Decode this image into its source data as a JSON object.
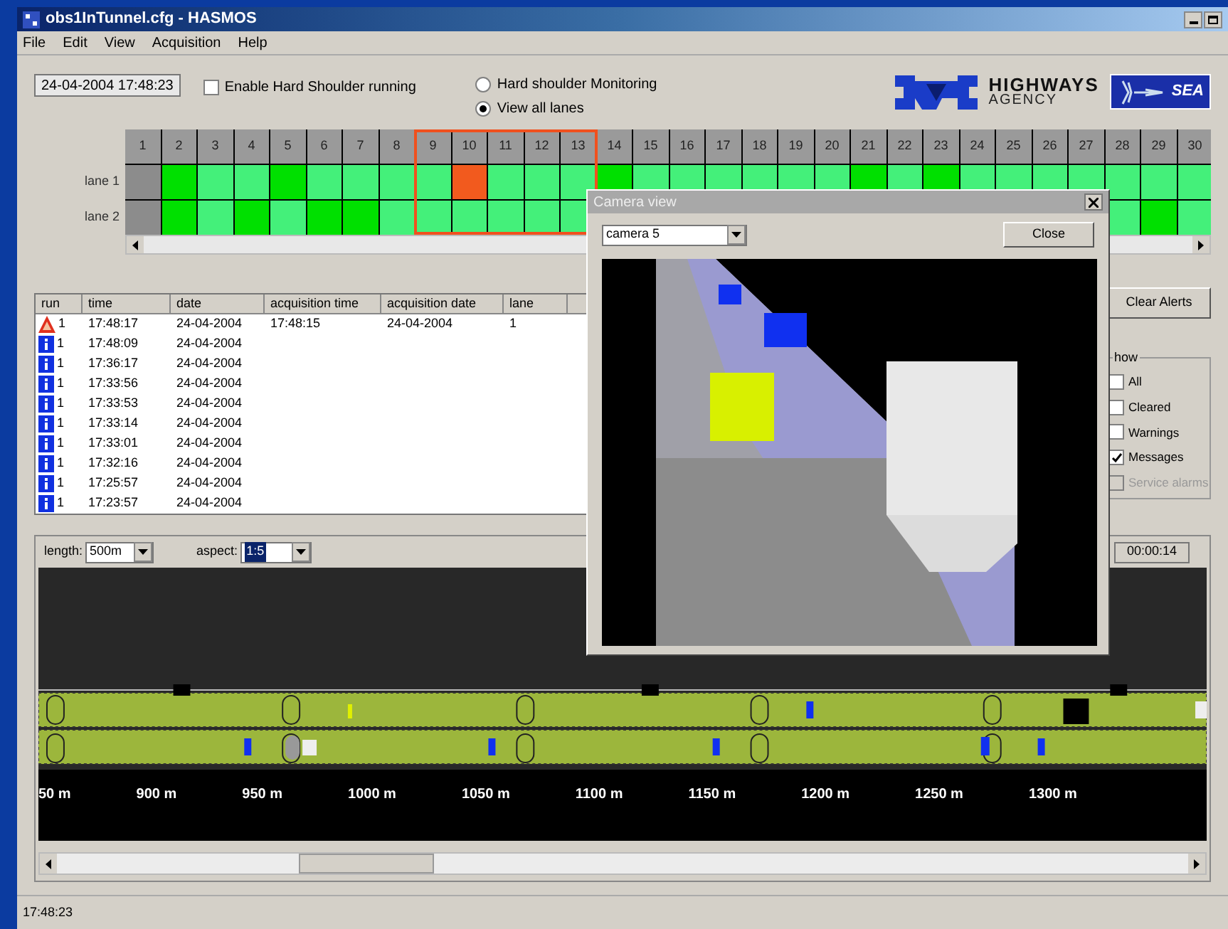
{
  "window": {
    "title": "obs1InTunnel.cfg - HASMOS"
  },
  "menu": [
    "File",
    "Edit",
    "View",
    "Acquisition",
    "Help"
  ],
  "clock": {
    "value": "24-04-2004 17:48:23"
  },
  "hard_shoulder_running": {
    "label": "Enable Hard Shoulder running",
    "checked": false
  },
  "view_mode": [
    {
      "label": "Hard shoulder Monitoring",
      "selected": false
    },
    {
      "label": "View all lanes",
      "selected": true
    }
  ],
  "logos": {
    "agency_name": "HIGHWAYS",
    "agency_sub": "AGENCY",
    "partner": "SEA"
  },
  "columns": [
    {
      "label": "1",
      "highlighted": false
    },
    {
      "label": "2",
      "highlighted": false
    },
    {
      "label": "3",
      "highlighted": false
    },
    {
      "label": "4",
      "highlighted": false
    },
    {
      "label": "5",
      "highlighted": false
    },
    {
      "label": "6",
      "highlighted": false
    },
    {
      "label": "7",
      "highlighted": false
    },
    {
      "label": "8",
      "highlighted": false
    },
    {
      "label": "9",
      "highlighted": true
    },
    {
      "label": "10",
      "highlighted": true
    },
    {
      "label": "11",
      "highlighted": true
    },
    {
      "label": "12",
      "highlighted": true
    },
    {
      "label": "13",
      "highlighted": true
    },
    {
      "label": "14",
      "highlighted": false
    },
    {
      "label": "15",
      "highlighted": false
    },
    {
      "label": "16",
      "highlighted": false
    },
    {
      "label": "17",
      "highlighted": false
    },
    {
      "label": "18",
      "highlighted": false
    },
    {
      "label": "19",
      "highlighted": false
    },
    {
      "label": "20",
      "highlighted": false
    },
    {
      "label": "21",
      "highlighted": false
    },
    {
      "label": "22",
      "highlighted": false
    },
    {
      "label": "23",
      "highlighted": false
    },
    {
      "label": "24",
      "highlighted": false
    },
    {
      "label": "25",
      "highlighted": false
    },
    {
      "label": "26",
      "highlighted": false
    },
    {
      "label": "27",
      "highlighted": false
    },
    {
      "label": "28",
      "highlighted": false
    },
    {
      "label": "29",
      "highlighted": false
    },
    {
      "label": "30",
      "highlighted": false
    }
  ],
  "lanes": [
    {
      "label": "lane 1",
      "cells": [
        {
          "color": "#8c8c8c"
        },
        {
          "color": "#00e000"
        },
        {
          "color": "#44f07a"
        },
        {
          "color": "#44f07a"
        },
        {
          "color": "#00e000"
        },
        {
          "color": "#44f07a"
        },
        {
          "color": "#44f07a"
        },
        {
          "color": "#44f07a"
        },
        {
          "color": "#44f07a"
        },
        {
          "color": "#f25a1e"
        },
        {
          "color": "#44f07a"
        },
        {
          "color": "#44f07a"
        },
        {
          "color": "#44f07a"
        },
        {
          "color": "#00e000"
        },
        {
          "color": "#44f07a"
        },
        {
          "color": "#44f07a"
        },
        {
          "color": "#44f07a"
        },
        {
          "color": "#44f07a"
        },
        {
          "color": "#44f07a"
        },
        {
          "color": "#44f07a"
        },
        {
          "color": "#00e000"
        },
        {
          "color": "#44f07a"
        },
        {
          "color": "#00e000"
        },
        {
          "color": "#44f07a"
        },
        {
          "color": "#44f07a"
        },
        {
          "color": "#44f07a"
        },
        {
          "color": "#44f07a"
        },
        {
          "color": "#44f07a"
        },
        {
          "color": "#44f07a"
        },
        {
          "color": "#44f07a"
        }
      ]
    },
    {
      "label": "lane 2",
      "cells": [
        {
          "color": "#8c8c8c"
        },
        {
          "color": "#00e000"
        },
        {
          "color": "#44f07a"
        },
        {
          "color": "#00e000"
        },
        {
          "color": "#44f07a"
        },
        {
          "color": "#00e000"
        },
        {
          "color": "#00e000"
        },
        {
          "color": "#44f07a"
        },
        {
          "color": "#44f07a"
        },
        {
          "color": "#44f07a"
        },
        {
          "color": "#44f07a"
        },
        {
          "color": "#44f07a"
        },
        {
          "color": "#44f07a"
        },
        null,
        null,
        null,
        null,
        null,
        null,
        null,
        null,
        null,
        null,
        null,
        null,
        null,
        null,
        {
          "color": "#44f07a"
        },
        {
          "color": "#00e000"
        },
        {
          "color": "#44f07a"
        }
      ]
    }
  ],
  "alerts": {
    "columns": [
      "run",
      "time",
      "date",
      "acquisition time",
      "acquisition date",
      "lane"
    ],
    "rows": [
      {
        "kind": "warning",
        "run": "1",
        "time": "17:48:17",
        "date": "24-04-2004",
        "acquisition_time": "17:48:15",
        "acquisition_date": "24-04-2004",
        "lane": "1"
      },
      {
        "kind": "info",
        "run": "1",
        "time": "17:48:09",
        "date": "24-04-2004"
      },
      {
        "kind": "info",
        "run": "1",
        "time": "17:36:17",
        "date": "24-04-2004"
      },
      {
        "kind": "info",
        "run": "1",
        "time": "17:33:56",
        "date": "24-04-2004"
      },
      {
        "kind": "info",
        "run": "1",
        "time": "17:33:53",
        "date": "24-04-2004"
      },
      {
        "kind": "info",
        "run": "1",
        "time": "17:33:14",
        "date": "24-04-2004"
      },
      {
        "kind": "info",
        "run": "1",
        "time": "17:33:01",
        "date": "24-04-2004"
      },
      {
        "kind": "info",
        "run": "1",
        "time": "17:32:16",
        "date": "24-04-2004"
      },
      {
        "kind": "info",
        "run": "1",
        "time": "17:25:57",
        "date": "24-04-2004"
      },
      {
        "kind": "info",
        "run": "1",
        "time": "17:23:57",
        "date": "24-04-2004"
      }
    ]
  },
  "clear_alerts": "Clear Alerts",
  "show": {
    "label": "how",
    "filters": [
      {
        "label": "All",
        "checked": false,
        "disabled": false
      },
      {
        "label": "Cleared",
        "checked": false,
        "disabled": false
      },
      {
        "label": "Warnings",
        "checked": false,
        "disabled": false
      },
      {
        "label": "Messages",
        "checked": true,
        "disabled": false
      },
      {
        "label": "Service alarms",
        "checked": false,
        "disabled": true
      }
    ]
  },
  "camera_dialog": {
    "title": "Camera view",
    "camera": "camera 5",
    "close": "Close"
  },
  "tunnel": {
    "length": {
      "label": "length:",
      "value": "500m"
    },
    "aspect": {
      "label": "aspect:",
      "value": "1:5"
    },
    "elapsed": "00:00:14",
    "distances": [
      "50 m",
      "900 m",
      "950 m",
      "1000 m",
      "1050 m",
      "1100 m",
      "1150 m",
      "1200 m",
      "1250 m",
      "1300 m"
    ]
  },
  "status_bar": "17:48:23"
}
